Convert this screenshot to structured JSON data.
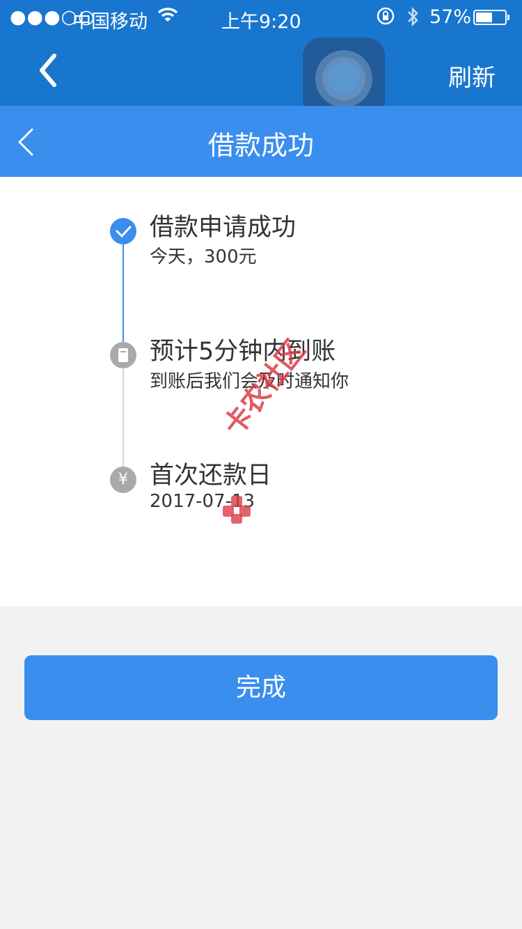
{
  "status_bar": {
    "signal": "●●●○○",
    "carrier": "中国移动",
    "wifi_icon": "wifi-icon",
    "time": "上午9:20",
    "rotation_lock_icon": "rotation-lock-icon",
    "bluetooth_icon": "bluetooth-icon",
    "battery_percent": "57%",
    "battery_level": 0.57
  },
  "outer_nav": {
    "back_icon": "chevron-left-icon",
    "refresh_label": "刷新"
  },
  "inner_nav": {
    "back_icon": "chevron-left-icon",
    "title": "借款成功"
  },
  "steps": [
    {
      "title": "借款申请成功",
      "subtitle": "今天，300元",
      "status": "done",
      "icon": "check-icon"
    },
    {
      "title": "预计5分钟内到账",
      "subtitle": "到账后我们会及时通知你",
      "status": "pending",
      "icon": "clipboard-icon"
    },
    {
      "title": "首次还款日",
      "subtitle": "2017-07-13",
      "status": "pending",
      "icon": "yen-icon",
      "icon_glyph": "¥"
    }
  ],
  "done_button_label": "完成",
  "watermark": "卡农社区",
  "colors": {
    "status_bar_bg": "#1976cf",
    "nav_bg": "#3a8eee",
    "accent": "#3a8eee",
    "pending_node": "#a9a9a9",
    "page_bg": "#f2f2f2"
  }
}
